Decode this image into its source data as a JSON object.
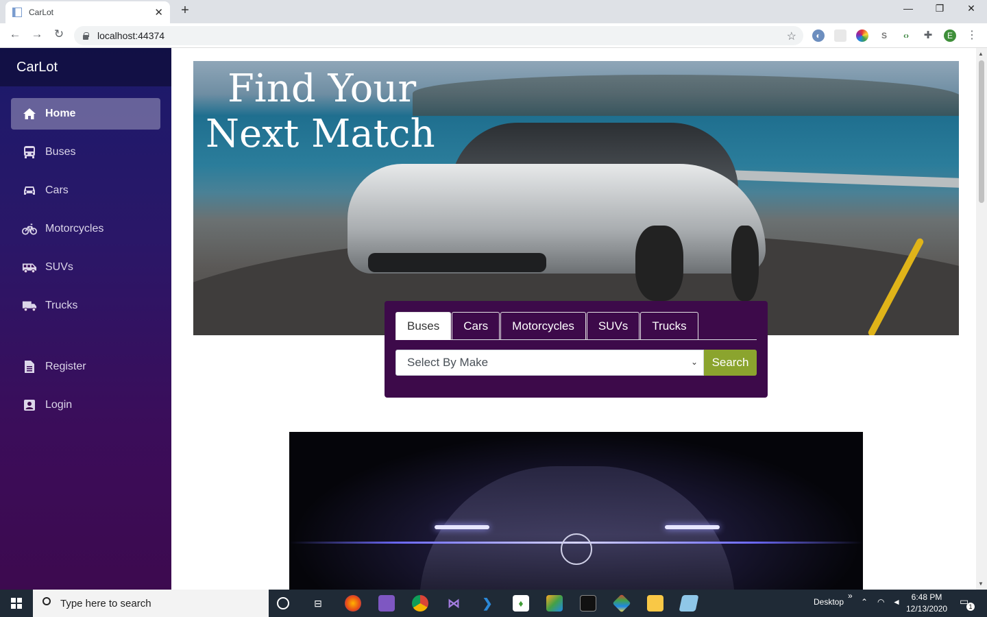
{
  "browser": {
    "tab_title": "CarLot",
    "url": "localhost:44374",
    "profile_initial": "E"
  },
  "sidebar": {
    "brand": "CarLot",
    "items": [
      {
        "label": "Home",
        "icon": "home-icon",
        "active": true
      },
      {
        "label": "Buses",
        "icon": "bus-icon",
        "active": false
      },
      {
        "label": "Cars",
        "icon": "car-icon",
        "active": false
      },
      {
        "label": "Motorcycles",
        "icon": "bicycle-icon",
        "active": false
      },
      {
        "label": "SUVs",
        "icon": "shuttle-van-icon",
        "active": false
      },
      {
        "label": "Trucks",
        "icon": "truck-icon",
        "active": false
      }
    ],
    "account": [
      {
        "label": "Register",
        "icon": "document-icon"
      },
      {
        "label": "Login",
        "icon": "user-badge-icon"
      }
    ]
  },
  "hero": {
    "title_line1": "Find Your",
    "title_line2": "Next Match"
  },
  "search": {
    "tabs": [
      "Buses",
      "Cars",
      "Motorcycles",
      "SUVs",
      "Trucks"
    ],
    "active_tab": "Buses",
    "select_value": "Select By Make",
    "button_label": "Search"
  },
  "taskbar": {
    "search_placeholder": "Type here to search",
    "desktop_label": "Desktop",
    "time": "6:48 PM",
    "date": "12/13/2020",
    "notification_count": "1"
  },
  "colors": {
    "sidebar_top": "#1b1a6b",
    "sidebar_bottom": "#3d0a4f",
    "search_panel": "#3d0a4a",
    "search_button": "#8ba42e"
  }
}
